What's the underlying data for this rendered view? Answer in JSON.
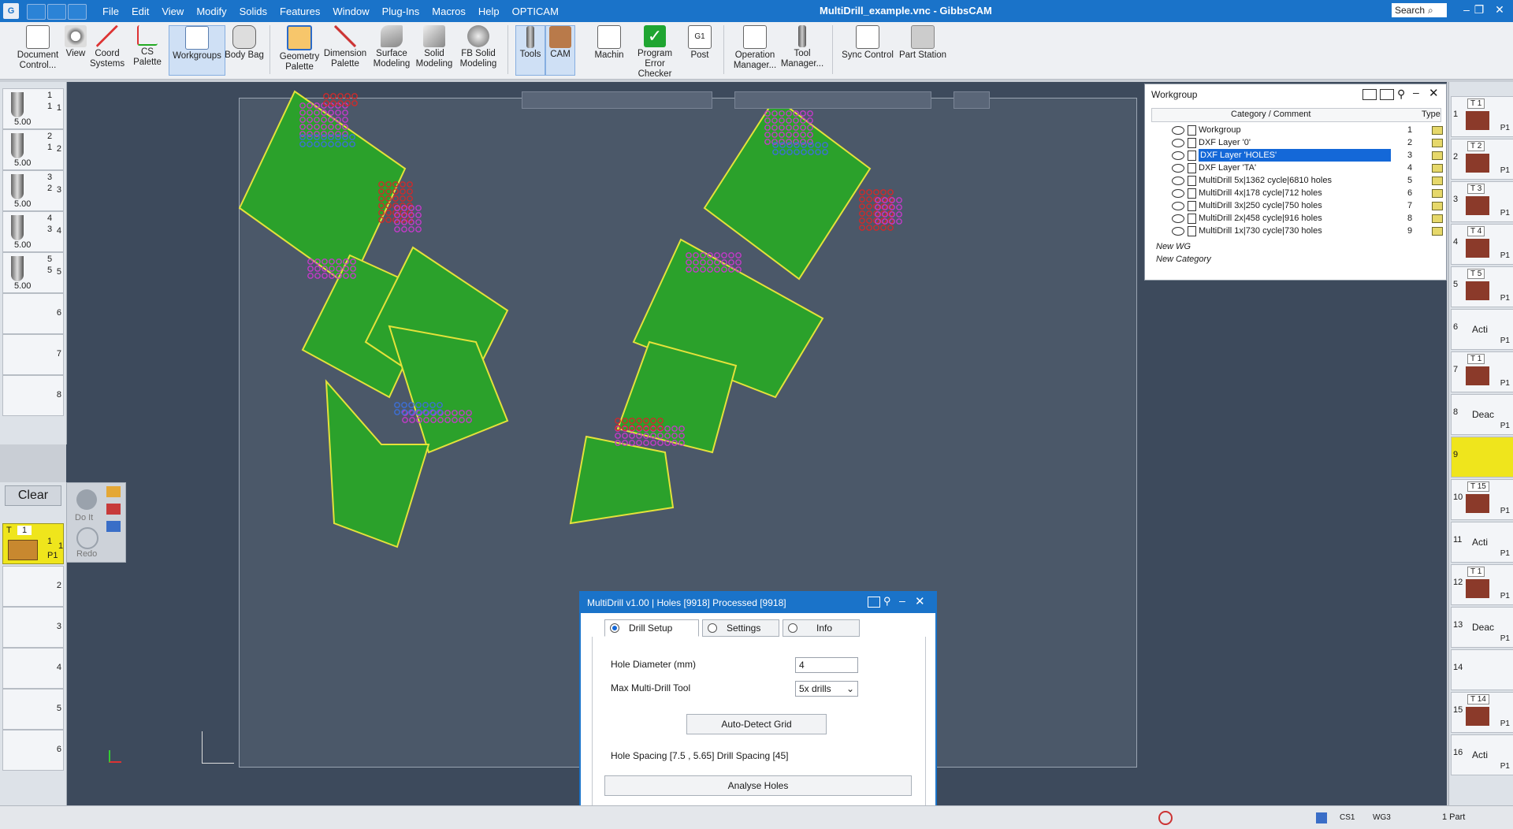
{
  "app": {
    "title": "MultiDrill_example.vnc - GibbsCAM",
    "logo": "G",
    "search_placeholder": "Search"
  },
  "menu": [
    "File",
    "Edit",
    "View",
    "Modify",
    "Solids",
    "Features",
    "Window",
    "Plug-Ins",
    "Macros",
    "Help",
    "OPTICAM"
  ],
  "window_controls": [
    "–",
    "❐",
    "✕"
  ],
  "ribbon": {
    "buttons": [
      {
        "label": "Document\nControl...",
        "icon": "document-icon"
      },
      {
        "label": "View",
        "icon": "view-icon"
      },
      {
        "label": "Coord\nSystems",
        "icon": "coord-systems-icon"
      },
      {
        "label": "CS Palette",
        "icon": "cs-palette-icon"
      },
      {
        "label": "Workgroups",
        "icon": "workgroups-icon"
      },
      {
        "label": "Body Bag",
        "icon": "body-bag-icon"
      },
      {
        "label": "Geometry\nPalette",
        "icon": "geometry-palette-icon"
      },
      {
        "label": "Dimension\nPalette",
        "icon": "dimension-palette-icon"
      },
      {
        "label": "Surface\nModeling",
        "icon": "surface-modeling-icon"
      },
      {
        "label": "Solid\nModeling",
        "icon": "solid-modeling-icon"
      },
      {
        "label": "FB Solid\nModeling",
        "icon": "fb-solid-modeling-icon"
      },
      {
        "label": "Tools",
        "icon": "tools-icon"
      },
      {
        "label": "CAM",
        "icon": "cam-icon"
      },
      {
        "label": "Machin",
        "icon": "machining-icon"
      },
      {
        "label": "Program\nError Checker",
        "icon": "error-checker-icon"
      },
      {
        "label": "Post",
        "icon": "post-icon"
      },
      {
        "label": "Operation\nManager...",
        "icon": "operation-manager-icon"
      },
      {
        "label": "Tool\nManager...",
        "icon": "tool-manager-icon"
      },
      {
        "label": "Sync Control",
        "icon": "sync-control-icon"
      },
      {
        "label": "Part Station",
        "icon": "part-station-icon"
      }
    ]
  },
  "left_tools": [
    {
      "num": "1",
      "sub": "1",
      "size": "5.00"
    },
    {
      "num": "2",
      "sub": "1",
      "size": "5.00"
    },
    {
      "num": "3",
      "sub": "2",
      "size": "5.00"
    },
    {
      "num": "4",
      "sub": "3",
      "size": "5.00"
    },
    {
      "num": "5",
      "sub": "5",
      "size": "5.00"
    },
    {
      "num": "6"
    },
    {
      "num": "7"
    },
    {
      "num": "8"
    }
  ],
  "clear_panel": {
    "clear_label": "Clear",
    "doit_label": "Do It",
    "redo_label": "Redo",
    "active_tool": {
      "t": "T",
      "num": "1",
      "line1": "1",
      "line2": "1",
      "p": "P1"
    },
    "rows": [
      "2",
      "3",
      "4",
      "5",
      "6"
    ]
  },
  "workgroup": {
    "title": "Workgroup",
    "col_category": "Category / Comment",
    "col_type": "Type",
    "rows": [
      {
        "name": "Workgroup",
        "idx": "1"
      },
      {
        "name": "DXF Layer '0'",
        "idx": "2"
      },
      {
        "name": "DXF Layer 'HOLES'",
        "idx": "3",
        "selected": true
      },
      {
        "name": "DXF Layer 'TA'",
        "idx": "4"
      },
      {
        "name": "MultiDrill 5x|1362 cycle|6810 holes",
        "idx": "5"
      },
      {
        "name": "MultiDrill 4x|178 cycle|712 holes",
        "idx": "6"
      },
      {
        "name": "MultiDrill 3x|250 cycle|750 holes",
        "idx": "7"
      },
      {
        "name": "MultiDrill 2x|458 cycle|916 holes",
        "idx": "8"
      },
      {
        "name": "MultiDrill 1x|730 cycle|730 holes",
        "idx": "9"
      }
    ],
    "new_wg": "New WG",
    "new_category": "New Category"
  },
  "right_processes": [
    {
      "num": "1",
      "tool": "T 1",
      "p": "P1"
    },
    {
      "num": "2",
      "tool": "T 2",
      "p": "P1"
    },
    {
      "num": "3",
      "tool": "T 3",
      "p": "P1"
    },
    {
      "num": "4",
      "tool": "T 4",
      "p": "P1"
    },
    {
      "num": "5",
      "tool": "T 5",
      "p": "P1"
    },
    {
      "num": "6",
      "label": "Acti",
      "p": "P1"
    },
    {
      "num": "7",
      "tool": "T 1",
      "p": "P1"
    },
    {
      "num": "8",
      "label": "Deac",
      "p": "P1"
    },
    {
      "num": "9",
      "label": ""
    },
    {
      "num": "10",
      "tool": "T 15",
      "p": "P1"
    },
    {
      "num": "11",
      "label": "Acti",
      "p": "P1"
    },
    {
      "num": "12",
      "tool": "T 1",
      "p": "P1"
    },
    {
      "num": "13",
      "label": "Deac",
      "p": "P1"
    },
    {
      "num": "14",
      "label": ""
    },
    {
      "num": "15",
      "tool": "T 14",
      "p": "P1"
    },
    {
      "num": "16",
      "label": "Acti",
      "p": "P1"
    }
  ],
  "dialog": {
    "title": "MultiDrill v1.00 | Holes [9918] Processed [9918]",
    "tabs": [
      "Drill Setup",
      "Settings",
      "Info"
    ],
    "active_tab": "Drill Setup",
    "hole_diameter_label": "Hole Diameter (mm)",
    "hole_diameter_value": "4",
    "max_tool_label": "Max Multi-Drill Tool",
    "max_tool_value": "5x drills",
    "auto_detect_label": "Auto-Detect Grid",
    "spacing_text": "Hole Spacing [7.5 , 5.65] Drill Spacing [45]",
    "analyse_label": "Analyse Holes"
  },
  "status": {
    "cs": "CS1",
    "wg": "WG3",
    "parts": "1 Part"
  },
  "colors": {
    "accent": "#1a73c9",
    "hole_5x": "#2ba12b",
    "hole_4x": "#3d6fd8",
    "hole_3x": "#c43ac9",
    "hole_2x": "#d02a2a",
    "hole_1x": "#d9c52a",
    "hole_outline": "#d9d93a"
  }
}
